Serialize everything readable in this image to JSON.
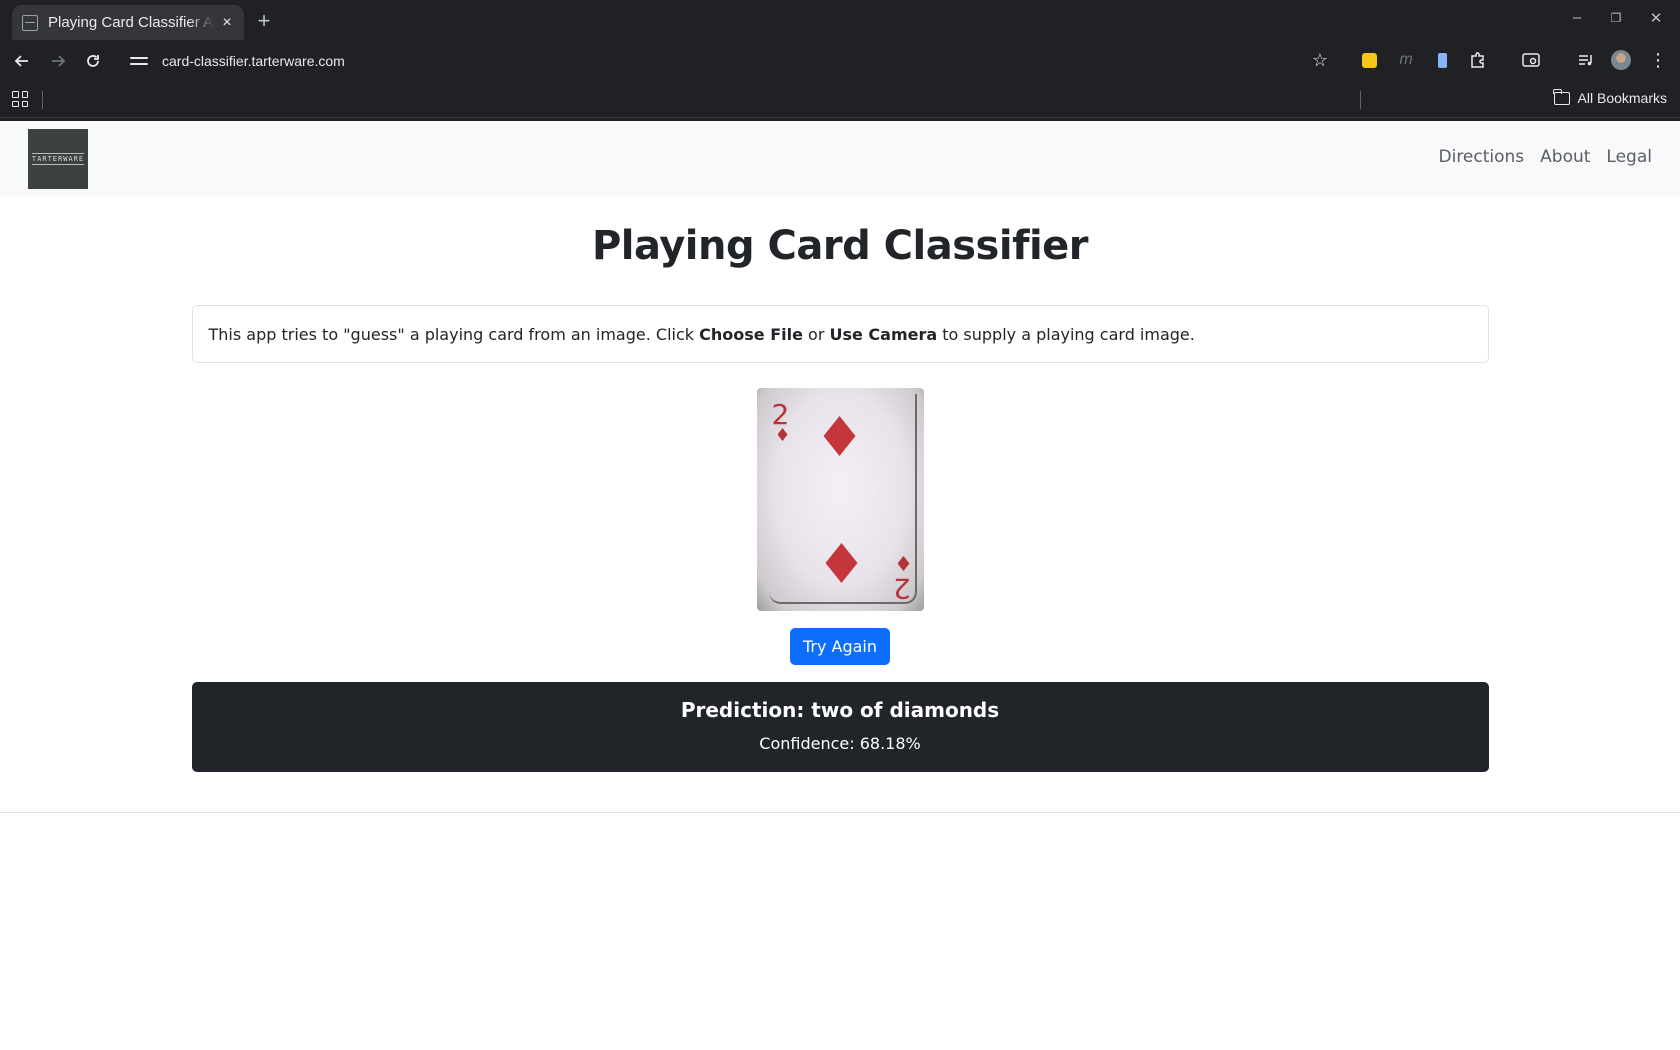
{
  "browser": {
    "tab_title": "Playing Card Classifier App",
    "tab_close": "×",
    "new_tab": "+",
    "url": "card-classifier.tarterware.com",
    "bookmarks_label": "All Bookmarks",
    "window_controls": {
      "minimize": "–",
      "restore": "❐",
      "close": "✕"
    }
  },
  "navbar": {
    "brand_text": "TARTERWARE",
    "links": [
      "Directions",
      "About",
      "Legal"
    ]
  },
  "main": {
    "title": "Playing Card Classifier",
    "info": {
      "prefix": "This app tries to \"guess\" a playing card from an image. Click ",
      "choose_file": "Choose File",
      "middle": " or ",
      "use_camera": "Use Camera",
      "suffix": " to supply a playing card image."
    },
    "card": {
      "rank": "2",
      "suit": "diamonds"
    },
    "try_again_label": "Try Again",
    "result": {
      "prediction": "Prediction: two of diamonds",
      "confidence": "Confidence: 68.18%"
    }
  },
  "colors": {
    "primary_button": "#0d6efd",
    "result_bg": "#212529",
    "card_red": "#c4363c"
  }
}
